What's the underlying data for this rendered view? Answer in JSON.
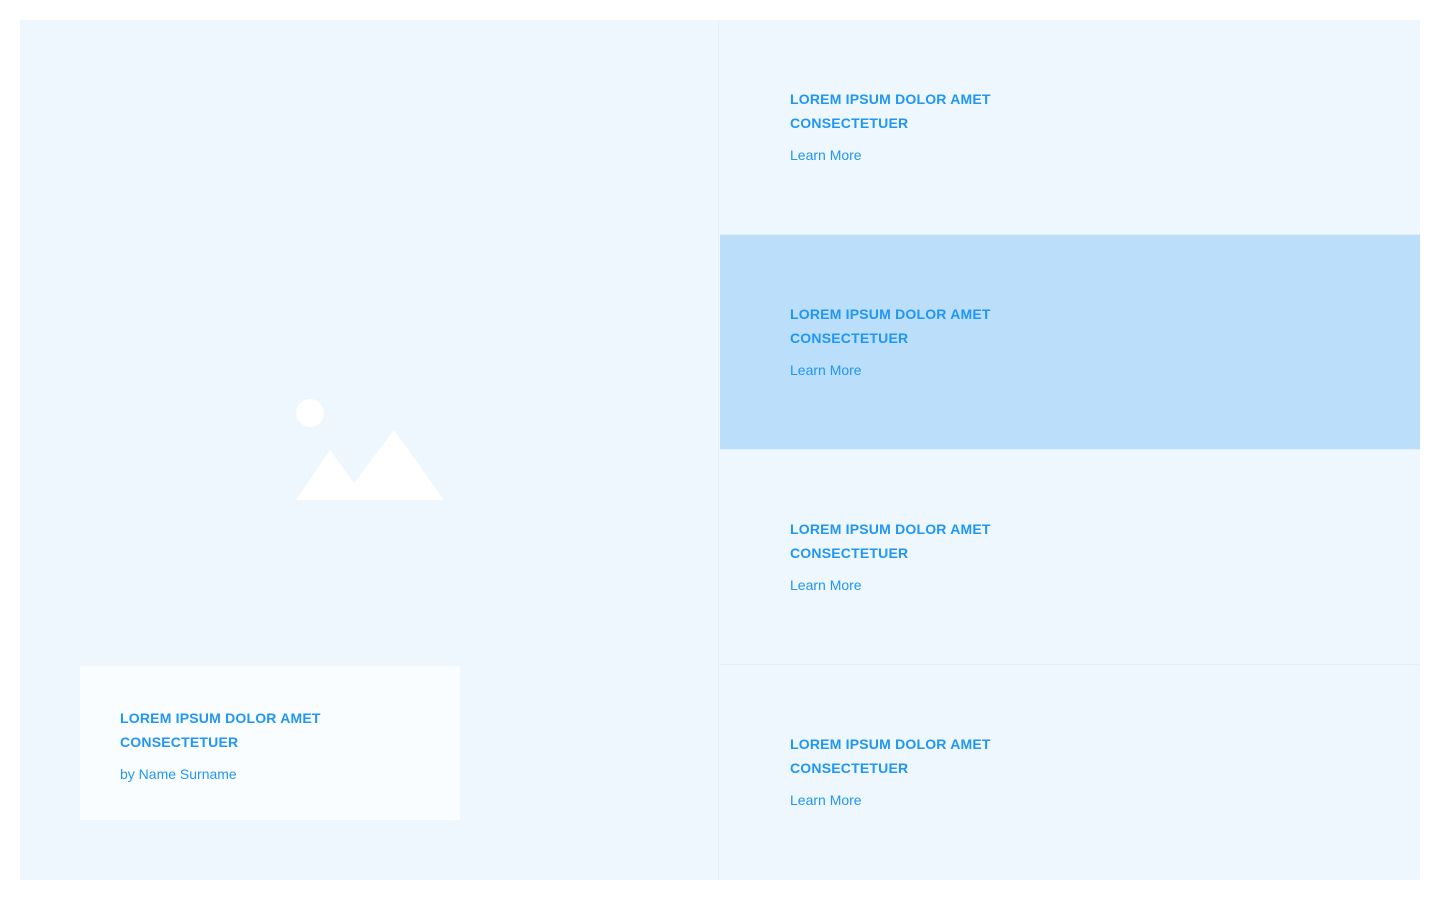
{
  "colors": {
    "accent": "#2196f3",
    "panel_background": "#eef7fe",
    "caption_background": "#fafdff",
    "active_item_background": "#bbdffb",
    "placeholder_icon": "#ffffff"
  },
  "hero": {
    "image_icon": "image-placeholder-icon",
    "caption": {
      "title": "LOREM IPSUM DOLOR AMET CONSECTETUER",
      "byline": "by Name Surname"
    }
  },
  "list": {
    "active_index": 1,
    "items": [
      {
        "title": "LOREM IPSUM DOLOR AMET CONSECTETUER",
        "link_label": "Learn More"
      },
      {
        "title": "LOREM IPSUM DOLOR AMET CONSECTETUER",
        "link_label": "Learn More"
      },
      {
        "title": "LOREM IPSUM DOLOR AMET CONSECTETUER",
        "link_label": "Learn More"
      },
      {
        "title": "LOREM IPSUM DOLOR AMET CONSECTETUER",
        "link_label": "Learn More"
      }
    ]
  }
}
